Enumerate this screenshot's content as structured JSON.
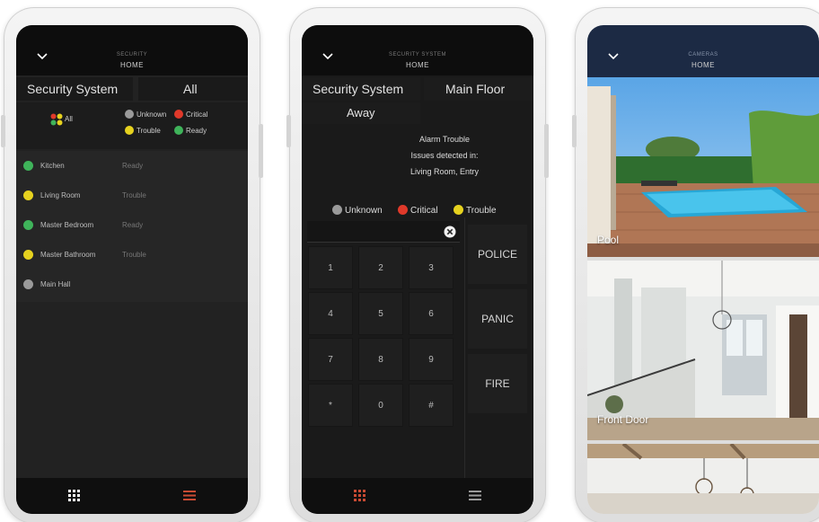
{
  "phone1": {
    "header": {
      "category": "SECURITY",
      "title": "HOME"
    },
    "system_name": "Security System",
    "filter": "All",
    "legend": {
      "all": "All",
      "unknown": "Unknown",
      "critical": "Critical",
      "trouble": "Trouble",
      "ready": "Ready"
    },
    "zones": [
      {
        "name": "Kitchen",
        "status": "Ready",
        "color": "#3fb35a"
      },
      {
        "name": "Living Room",
        "status": "Trouble",
        "color": "#e6d21f"
      },
      {
        "name": "Master Bedroom",
        "status": "Ready",
        "color": "#3fb35a"
      },
      {
        "name": "Master Bathroom",
        "status": "Trouble",
        "color": "#e6d21f"
      },
      {
        "name": "Main Hall",
        "status": "",
        "color": "#9a9a9a"
      }
    ]
  },
  "phone2": {
    "header": {
      "category": "SECURITY SYSTEM",
      "title": "HOME"
    },
    "system_name": "Security System",
    "partition": "Main Floor",
    "mode": "Away",
    "message": {
      "line1": "Alarm Trouble",
      "line2": "Issues detected in:",
      "line3": "Living Room, Entry"
    },
    "legend": {
      "unknown": "Unknown",
      "critical": "Critical",
      "trouble": "Trouble"
    },
    "keypad": [
      "1",
      "2",
      "3",
      "4",
      "5",
      "6",
      "7",
      "8",
      "9",
      "*",
      "0",
      "#"
    ],
    "emergency": {
      "police": "POLICE",
      "panic": "PANIC",
      "fire": "FIRE"
    }
  },
  "phone3": {
    "header": {
      "category": "CAMERAS",
      "title": "HOME"
    },
    "cameras": [
      {
        "label": "Pool"
      },
      {
        "label": "Front Door"
      },
      {
        "label": ""
      }
    ]
  },
  "colors": {
    "ready": "#3fb35a",
    "trouble": "#e6d21f",
    "critical": "#e0392a",
    "unknown": "#9a9a9a",
    "accent": "#c94b33",
    "camera_header": "#1c2a44"
  }
}
